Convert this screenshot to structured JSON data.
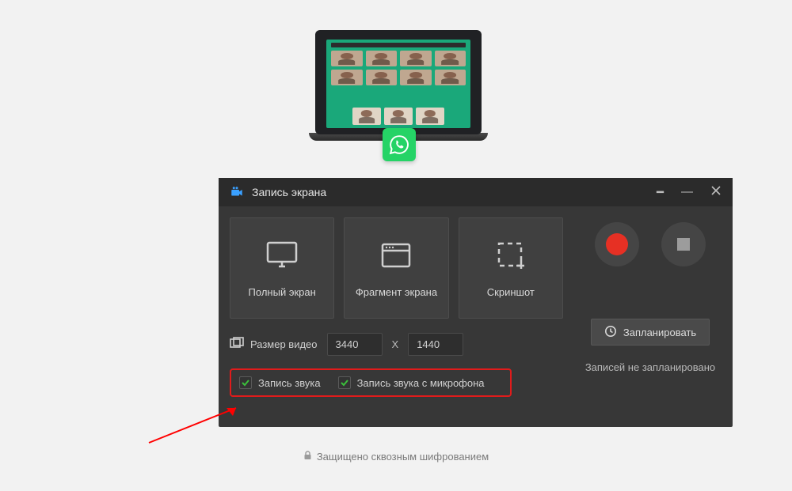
{
  "recorder": {
    "title": "Запись экрана",
    "cards": {
      "full": "Полный экран",
      "fragment": "Фрагмент экрана",
      "screenshot": "Скриншот"
    },
    "size_label": "Размер видео",
    "size": {
      "w": "3440",
      "sep": "X",
      "h": "1440"
    },
    "audio": {
      "sound": "Запись звука",
      "mic": "Запись звука с микрофона"
    },
    "schedule_button": "Запланировать",
    "schedule_note": "Записей не запланировано"
  },
  "footer": {
    "text": "Защищено сквозным шифрованием"
  },
  "colors": {
    "accent_green": "#25d366",
    "record_red": "#e63024",
    "highlight_red": "#e11b1b"
  }
}
